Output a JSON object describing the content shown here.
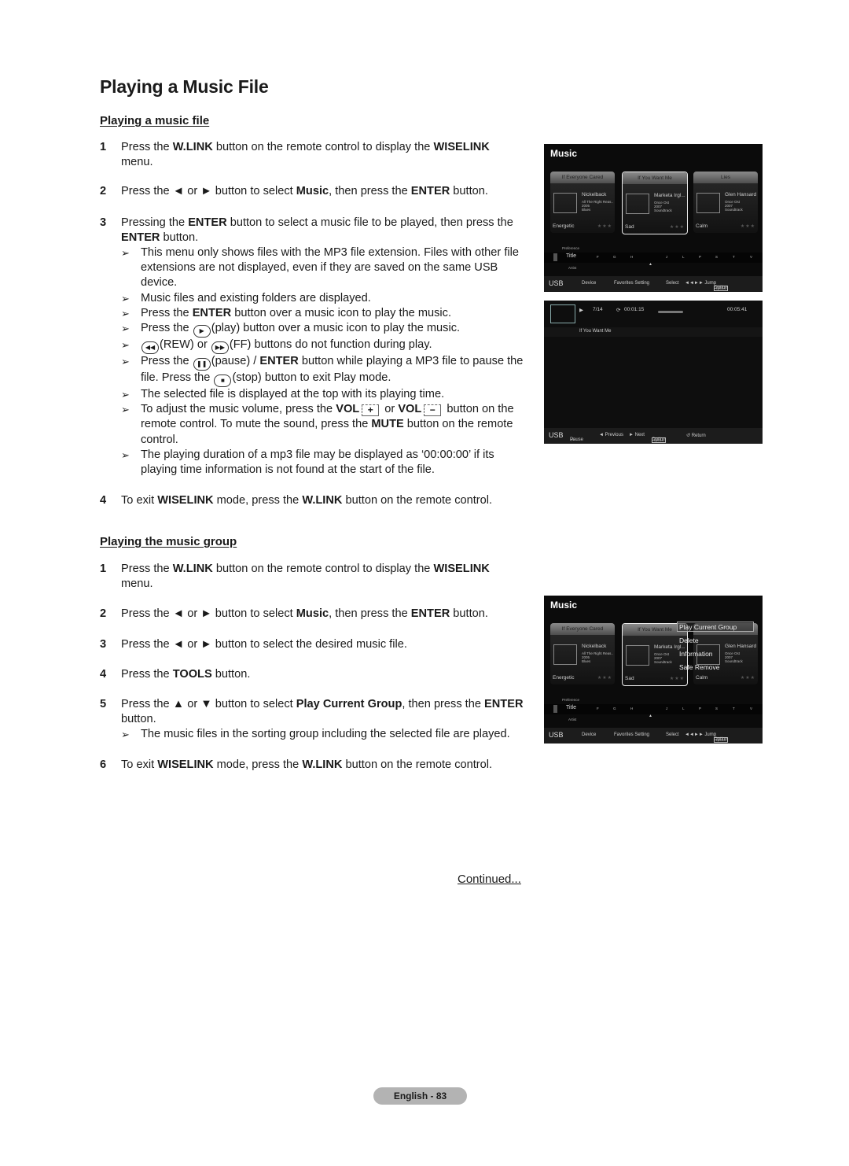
{
  "page_title": "Playing a Music File",
  "section1": {
    "title": "Playing a music file",
    "steps": [
      {
        "num": "1",
        "parts": [
          "Press the ",
          "W.LINK",
          " button on the remote control to display the ",
          "WISELINK",
          " menu."
        ]
      },
      {
        "num": "2",
        "parts": [
          "Press the ◄ or ► button to select ",
          "Music",
          ", then press the ",
          "ENTER",
          " button."
        ]
      },
      {
        "num": "3",
        "parts": [
          "Pressing the ",
          "ENTER",
          " button to select a music file to be played, then press the ",
          "ENTER",
          " button."
        ]
      },
      {
        "num": "4",
        "parts": [
          "To exit ",
          "WISELINK",
          " mode, press the ",
          "W.LINK",
          " button on the remote control."
        ]
      }
    ],
    "notes": {
      "n1": "This menu only shows files with the MP3 file extension. Files with other file extensions are not displayed, even if they are saved on the same USB device.",
      "n2": "Music files and existing folders are displayed.",
      "n3a": "Press the ",
      "n3b": "ENTER",
      "n3c": " button over a music icon to play the music.",
      "n4a": "Press the ",
      "n4b": "(play) button over a music icon to play the music.",
      "n5a": "(REW) or ",
      "n5b": "(FF) buttons do not function during play.",
      "n6a": "Press the ",
      "n6b": "(pause) / ",
      "n6c": "ENTER",
      "n6d": " button while playing a MP3 file to pause the file. Press the ",
      "n6e": "(stop) button to exit Play mode.",
      "n7": "The selected file is displayed at the top with its playing time.",
      "n8a": "To adjust the music volume, press the ",
      "n8b": "VOL",
      "n8c": " or ",
      "n8d": "VOL",
      "n8e": " button on the remote control. To mute the sound, press the ",
      "n8f": "MUTE",
      "n8g": " button on the remote control.",
      "n9": "The playing duration of a mp3 file may be displayed as ‘00:00:00’ if its playing time information is not found at the start of the file."
    }
  },
  "section2": {
    "title": "Playing the music group",
    "steps": [
      {
        "num": "1",
        "parts": [
          "Press the ",
          "W.LINK",
          " button on the remote control to display the ",
          "WISELINK",
          " menu."
        ]
      },
      {
        "num": "2",
        "parts": [
          "Press the ◄ or ► button to select ",
          "Music",
          ", then press the ",
          "ENTER",
          " button."
        ]
      },
      {
        "num": "3",
        "parts": [
          "Press the ◄ or ► button to select the desired music file."
        ]
      },
      {
        "num": "4",
        "parts": [
          "Press the ",
          "TOOLS",
          " button."
        ]
      },
      {
        "num": "5",
        "parts": [
          "Press the ▲ or ▼ button to select ",
          "Play Current Group",
          ", then press the ",
          "ENTER",
          " button."
        ]
      },
      {
        "num": "6",
        "parts": [
          "To exit ",
          "WISELINK",
          " mode, press the ",
          "W.LINK",
          " button on the remote control."
        ]
      }
    ],
    "note": "The music files in the sorting group including the selected file are played."
  },
  "continued": "Continued...",
  "page_number": "English - 83",
  "tv_menu": {
    "title": "Music",
    "cards": [
      {
        "title": "If Everyone Cared",
        "artist": "Nickelback",
        "meta": "All The Right Reas..\n2005\nBlues",
        "mood": "Energetic",
        "stars": "★★★"
      },
      {
        "title": "If You Want Me",
        "artist": "Marketa Irgl...",
        "meta": "Once Ost\n2007\nSoundtrack",
        "mood": "Sad",
        "stars": "★★★"
      },
      {
        "title": "Lies",
        "artist": "Glen Hansard",
        "meta": "Once Ost\n2007\nSoundtrack",
        "mood": "Calm",
        "stars": "★★★"
      }
    ],
    "sort_above": "Preference",
    "sort_current": "Title",
    "sort_below": "Artist",
    "letters": [
      "F",
      "G",
      "H",
      "J",
      "L",
      "P",
      "S",
      "T",
      "V"
    ],
    "footer": {
      "usb": "USB",
      "device": "Device",
      "favorites": "Favorites Setting",
      "select": "Select",
      "jump": "◄◄►► Jump",
      "tools": "TOOLS",
      "option": "Option"
    }
  },
  "tv_player": {
    "play_icon": "▶",
    "track": "7/14",
    "elapsed": "00:01:15",
    "total": "00:05:41",
    "song": "If You Want Me",
    "footer": {
      "usb": "USB",
      "pause": "Pause",
      "previous": "◄ Previous",
      "next": "► Next",
      "tools": "TOOLS",
      "option": "Option",
      "return": "↺ Return"
    }
  },
  "tools_popup": {
    "items": [
      "Play Current Group",
      "Delete",
      "Information",
      "Safe Remove"
    ],
    "selected": "Play Current Group"
  }
}
